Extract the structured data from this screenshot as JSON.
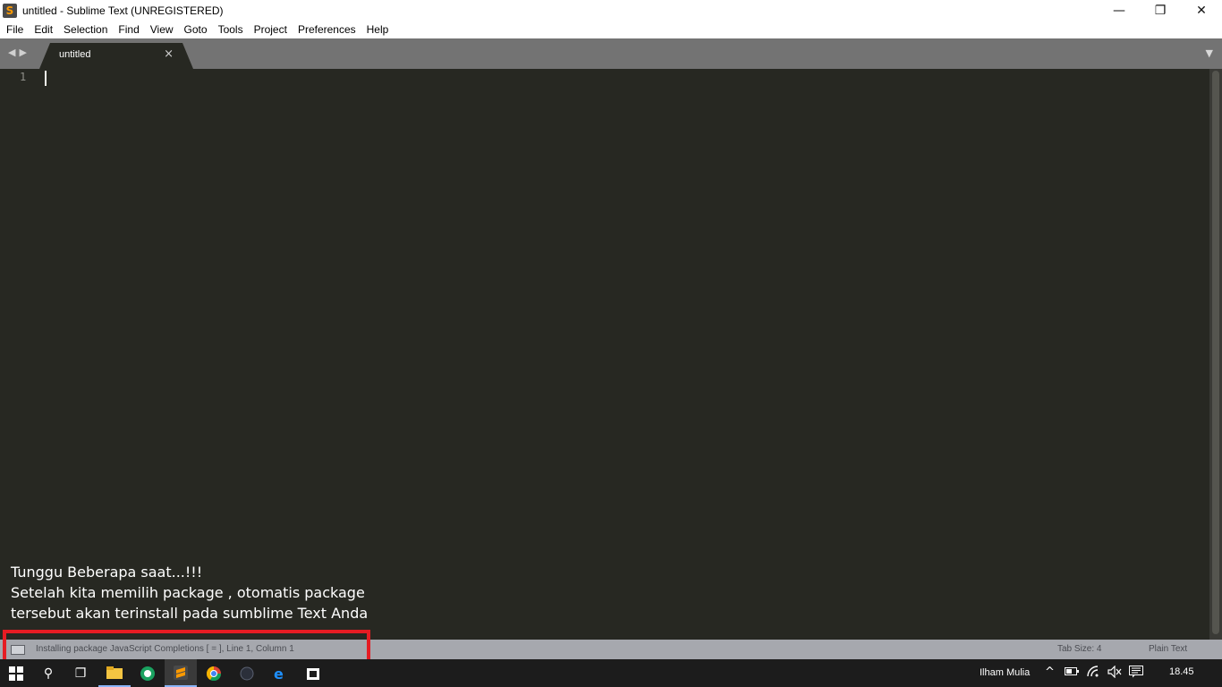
{
  "window": {
    "app_icon_glyph": "S",
    "title": "untitled - Sublime Text (UNREGISTERED)",
    "minimize": "—",
    "maximize": "❐",
    "close": "✕"
  },
  "menu": {
    "items": [
      "File",
      "Edit",
      "Selection",
      "Find",
      "View",
      "Goto",
      "Tools",
      "Project",
      "Preferences",
      "Help"
    ]
  },
  "tabs": {
    "prev_glyph": "◀",
    "next_glyph": "▶",
    "active_label": "untitled",
    "close_glyph": "×",
    "dropdown_glyph": "▼"
  },
  "editor": {
    "line_numbers": [
      "1"
    ],
    "content": ""
  },
  "overlay_text": [
    "Tunggu Beberapa saat...!!!",
    "Setelah kita memilih package , otomatis package",
    "tersebut akan terinstall pada sumblime Text Anda"
  ],
  "statusbar": {
    "message": "Installing package JavaScript Completions [     = ], Line 1, Column 1",
    "tab_size": "Tab Size: 4",
    "syntax": "Plain Text"
  },
  "taskbar": {
    "search_glyph": "⚲",
    "taskview_glyph": "❐",
    "apps": [
      "file-explorer",
      "green-app",
      "sublime-text",
      "chrome",
      "dark-app",
      "edge",
      "store"
    ],
    "user": "Ilham Mulia",
    "tray_chevron": "^",
    "time": "18.45"
  },
  "colors": {
    "editor_bg": "#272822",
    "tabbar_bg": "#737373",
    "statusbar_bg": "#a6a8ae",
    "highlight": "#e51c23",
    "taskbar_bg": "#1c1c1c"
  }
}
